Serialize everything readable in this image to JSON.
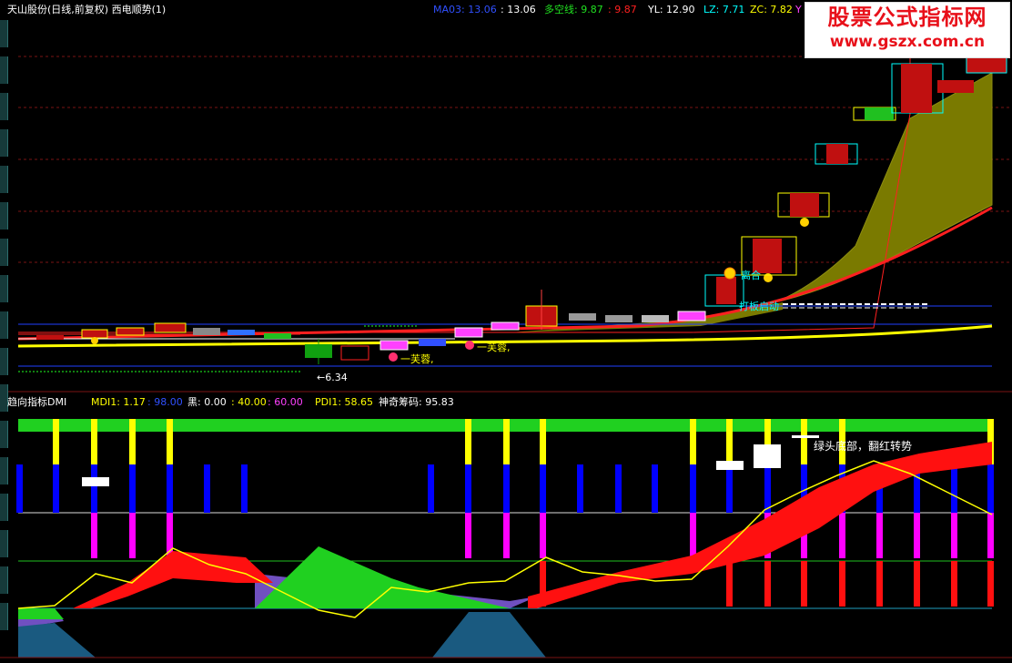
{
  "header": {
    "title": "天山股份(日线,前复权) 西电顺势(1)",
    "ma03_label": "MA03: 13.06",
    "ma03_value": ": 13.06",
    "dkx_label": "多空线: 9.87",
    "dkx_value": ": 9.87",
    "yl": "YL: 12.90",
    "lz": "LZ: 7.71",
    "zc": "ZC: 7.82",
    "y_tail": "Y"
  },
  "indicator_header": {
    "title": "趋向指标DMI",
    "mdi": "MDI1: 1.17",
    "mdi_value": ": 98.00",
    "hei": "黑: 0.00",
    "v40": ": 40.00",
    "v60": ": 60.00",
    "pdi": "PDI1: 58.65",
    "shenqi": "神奇筹码: 95.83"
  },
  "watermark": {
    "line1": "股票公式指标网",
    "line2": "www.gszx.com.cn"
  },
  "annotations": {
    "low_price": "←6.34",
    "fu_rong_1": "一芙蓉,",
    "fu_rong_2": "一芙蓉,",
    "da_ban": "打板启动",
    "huan_he": "离合",
    "green_head": "绿头底部，翻红转势"
  },
  "colors": {
    "background": "#000000",
    "up_candle": "#e01010",
    "down_candle": "#10c010",
    "yellow": "#ffff00",
    "blue": "#0000ff",
    "magenta": "#ff00ff",
    "olive_fill": "#7a7a00",
    "cyan": "#00ffff",
    "watermark_red": "#e8101a"
  }
}
